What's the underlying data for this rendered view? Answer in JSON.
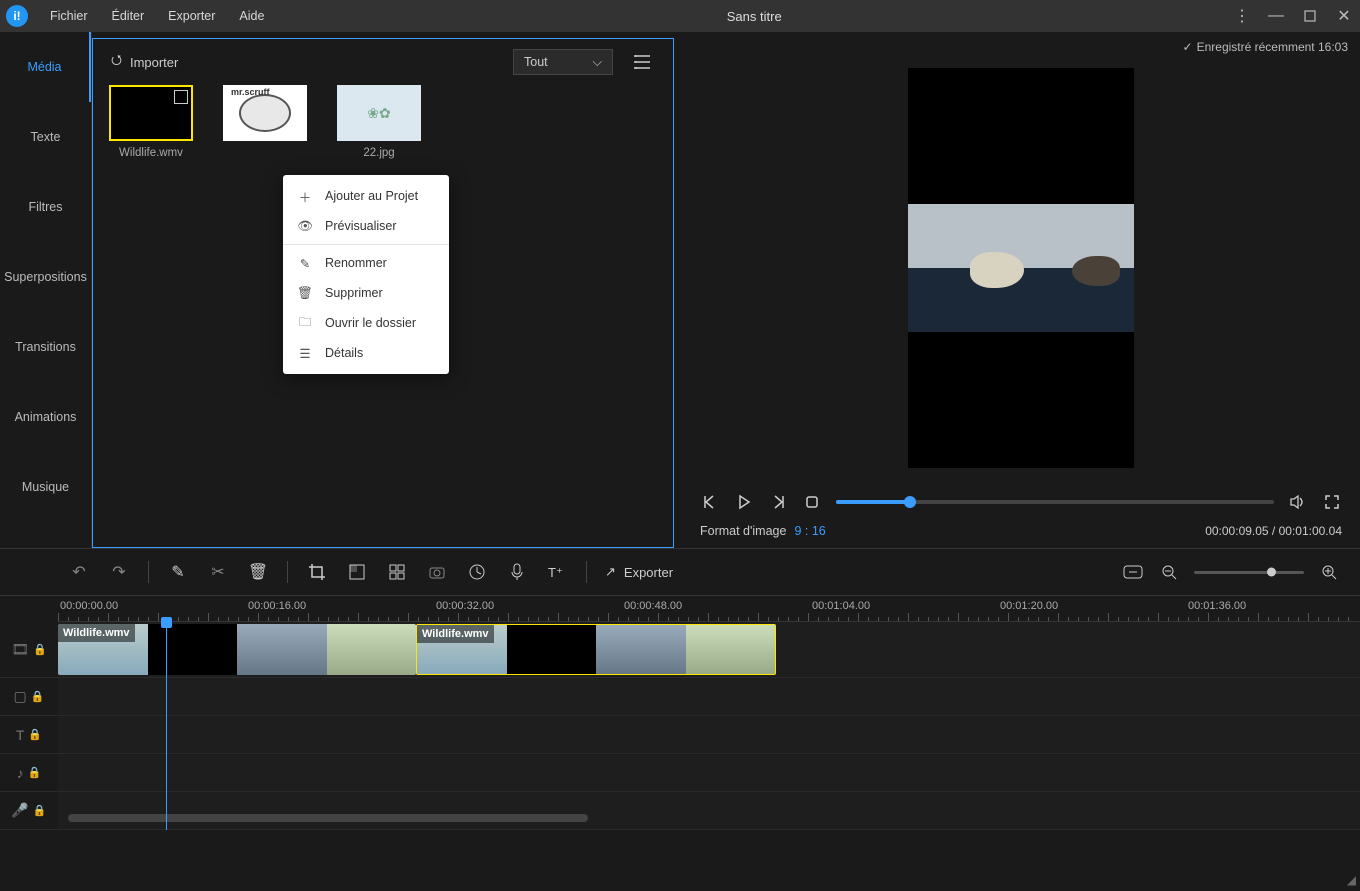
{
  "titlebar": {
    "title": "Sans titre",
    "menus": [
      "Fichier",
      "Éditer",
      "Exporter",
      "Aide"
    ]
  },
  "saved_status": "Enregistré récemment 16:03",
  "sidebar": {
    "tabs": [
      "Média",
      "Texte",
      "Filtres",
      "Superpositions",
      "Transitions",
      "Animations",
      "Musique"
    ]
  },
  "media_panel": {
    "import_label": "Importer",
    "filter_label": "Tout",
    "items": [
      {
        "label": "Wildlife.wmv"
      },
      {
        "label": ""
      },
      {
        "label": "22.jpg"
      }
    ]
  },
  "context_menu": {
    "items": [
      "Ajouter au Projet",
      "Prévisualiser",
      "Renommer",
      "Supprimer",
      "Ouvrir le dossier",
      "Détails"
    ]
  },
  "preview": {
    "aspect_label": "Format d'image",
    "aspect_value": "9 : 16",
    "timecode": "00:00:09.05 / 00:01:00.04"
  },
  "toolbar": {
    "export_label": "Exporter"
  },
  "timeline": {
    "ruler": [
      "00:00:00.00",
      "00:00:16.00",
      "00:00:32.00",
      "00:00:48.00",
      "00:01:04.00",
      "00:01:20.00",
      "00:01:36.00"
    ],
    "clips": [
      {
        "label": "Wildlife.wmv"
      },
      {
        "label": "Wildlife.wmv"
      }
    ]
  }
}
